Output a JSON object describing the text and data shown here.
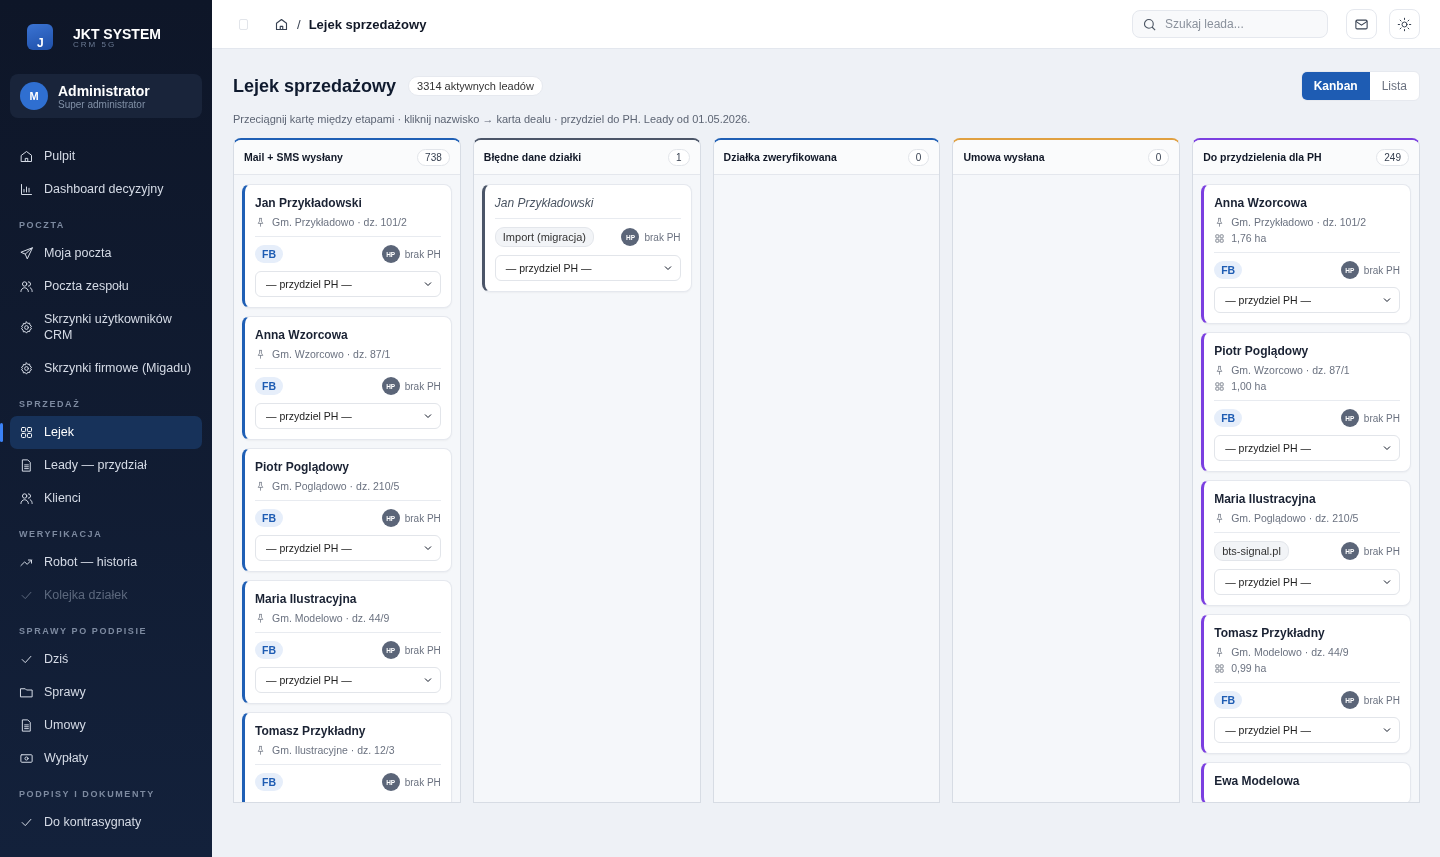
{
  "sidebar": {
    "brand": {
      "logo_letter": "J",
      "name": "JKT SYSTEM",
      "subtitle": "CRM 5G"
    },
    "user": {
      "initial": "M",
      "name": "Administrator",
      "role": "Super administrator"
    },
    "sections": [
      {
        "items": [
          {
            "label": "Pulpit",
            "kind": "home",
            "selected": false,
            "disabled": false
          },
          {
            "label": "Dashboard decyzyjny",
            "kind": "chart",
            "selected": false,
            "disabled": false
          }
        ]
      },
      {
        "label": "POCZTA",
        "items": [
          {
            "label": "Moja poczta",
            "kind": "send",
            "selected": false,
            "disabled": false
          },
          {
            "label": "Poczta zespołu",
            "kind": "users",
            "selected": false,
            "disabled": false
          },
          {
            "label": "Skrzynki użytkowników CRM",
            "kind": "gear",
            "selected": false,
            "disabled": false
          },
          {
            "label": "Skrzynki firmowe (Migadu)",
            "kind": "gear",
            "selected": false,
            "disabled": false
          }
        ]
      },
      {
        "label": "SPRZEDAŻ",
        "items": [
          {
            "label": "Lejek",
            "kind": "grid",
            "selected": true,
            "disabled": false
          },
          {
            "label": "Leady — przydział",
            "kind": "doc",
            "selected": false,
            "disabled": false
          },
          {
            "label": "Klienci",
            "kind": "users",
            "selected": false,
            "disabled": false
          }
        ]
      },
      {
        "label": "WERYFIKACJA",
        "items": [
          {
            "label": "Robot — historia",
            "kind": "trend",
            "selected": false,
            "disabled": false
          },
          {
            "label": "Kolejka działek",
            "kind": "check",
            "selected": false,
            "disabled": true
          }
        ]
      },
      {
        "label": "SPRAWY PO PODPISIE",
        "items": [
          {
            "label": "Dziś",
            "kind": "check",
            "selected": false,
            "disabled": false
          },
          {
            "label": "Sprawy",
            "kind": "folder",
            "selected": false,
            "disabled": false
          },
          {
            "label": "Umowy",
            "kind": "doc",
            "selected": false,
            "disabled": false
          },
          {
            "label": "Wypłaty",
            "kind": "money",
            "selected": false,
            "disabled": false
          }
        ]
      },
      {
        "label": "PODPISY I DOKUMENTY",
        "items": [
          {
            "label": "Do kontrasygnaty",
            "kind": "check",
            "selected": false,
            "disabled": false
          }
        ]
      }
    ]
  },
  "topbar": {
    "breadcrumb": "Lejek sprzedażowy",
    "separator": "/",
    "search": {
      "placeholder": "Szukaj leada..."
    }
  },
  "page": {
    "title": "Lejek sprzedażowy",
    "badge": "3314 aktywnych leadów",
    "hint": "Przeciągnij kartę między etapami · kliknij nazwisko → karta dealu · przydziel do PH. Leady od 01.05.2026.",
    "views": [
      {
        "label": "Kanban",
        "selected": true
      },
      {
        "label": "Lista",
        "selected": false
      }
    ]
  },
  "columns": [
    {
      "title": "Mail + SMS wysłany",
      "count": "738",
      "color": "#1f5fb5",
      "cards": [
        {
          "name": "Jan Przykładowski",
          "muted": false,
          "location": "Gm. Przykładowo · dz. 101/2",
          "source": {
            "label": "FB",
            "kind": "fb"
          },
          "avatar": "HP",
          "owner": "brak PH",
          "assign": "— przydziel PH —"
        },
        {
          "name": "Anna Wzorcowa",
          "muted": false,
          "location": "Gm. Wzorcowo · dz. 87/1",
          "source": {
            "label": "FB",
            "kind": "fb"
          },
          "avatar": "HP",
          "owner": "brak PH",
          "assign": "— przydziel PH —"
        },
        {
          "name": "Piotr Poglądowy",
          "muted": false,
          "location": "Gm. Poglądowo · dz. 210/5",
          "source": {
            "label": "FB",
            "kind": "fb"
          },
          "avatar": "HP",
          "owner": "brak PH",
          "assign": "— przydziel PH —"
        },
        {
          "name": "Maria Ilustracyjna",
          "muted": false,
          "location": "Gm. Modelowo · dz. 44/9",
          "source": {
            "label": "FB",
            "kind": "fb"
          },
          "avatar": "HP",
          "owner": "brak PH",
          "assign": "— przydziel PH —"
        },
        {
          "name": "Tomasz Przykładny",
          "muted": false,
          "location": "Gm. Ilustracyjne · dz. 12/3",
          "source": {
            "label": "FB",
            "kind": "fb"
          },
          "avatar": "HP",
          "owner": "brak PH"
        }
      ]
    },
    {
      "title": "Błędne dane działki",
      "count": "1",
      "color": "#4b5568",
      "cards": [
        {
          "name": "Jan Przykładowski",
          "muted": true,
          "source": {
            "label": "Import (migracja)",
            "kind": "other"
          },
          "avatar": "HP",
          "owner": "brak PH",
          "assign": "— przydziel PH —"
        }
      ]
    },
    {
      "title": "Działka zweryfikowana",
      "count": "0",
      "color": "#1f5fb5"
    },
    {
      "title": "Umowa wysłana",
      "count": "0",
      "color": "#e0a040"
    },
    {
      "title": "Do przydzielenia dla PH",
      "count": "249",
      "color": "#7b3fe0",
      "cards": [
        {
          "name": "Anna Wzorcowa",
          "muted": false,
          "location": "Gm. Przykładowo · dz. 101/2",
          "area": "1,76 ha",
          "source": {
            "label": "FB",
            "kind": "fb"
          },
          "avatar": "HP",
          "owner": "brak PH",
          "assign": "— przydziel PH —"
        },
        {
          "name": "Piotr Poglądowy",
          "muted": false,
          "location": "Gm. Wzorcowo · dz. 87/1",
          "area": "1,00 ha",
          "source": {
            "label": "FB",
            "kind": "fb"
          },
          "avatar": "HP",
          "owner": "brak PH",
          "assign": "— przydziel PH —"
        },
        {
          "name": "Maria Ilustracyjna",
          "muted": false,
          "location": "Gm. Poglądowo · dz. 210/5",
          "source": {
            "label": "bts-signal.pl",
            "kind": "other"
          },
          "avatar": "HP",
          "owner": "brak PH",
          "assign": "— przydziel PH —"
        },
        {
          "name": "Tomasz Przykładny",
          "muted": false,
          "location": "Gm. Modelowo · dz. 44/9",
          "area": "0,99 ha",
          "source": {
            "label": "FB",
            "kind": "fb"
          },
          "avatar": "HP",
          "owner": "brak PH",
          "assign": "— przydziel PH —"
        },
        {
          "name": "Ewa Modelowa",
          "muted": false
        }
      ]
    }
  ]
}
